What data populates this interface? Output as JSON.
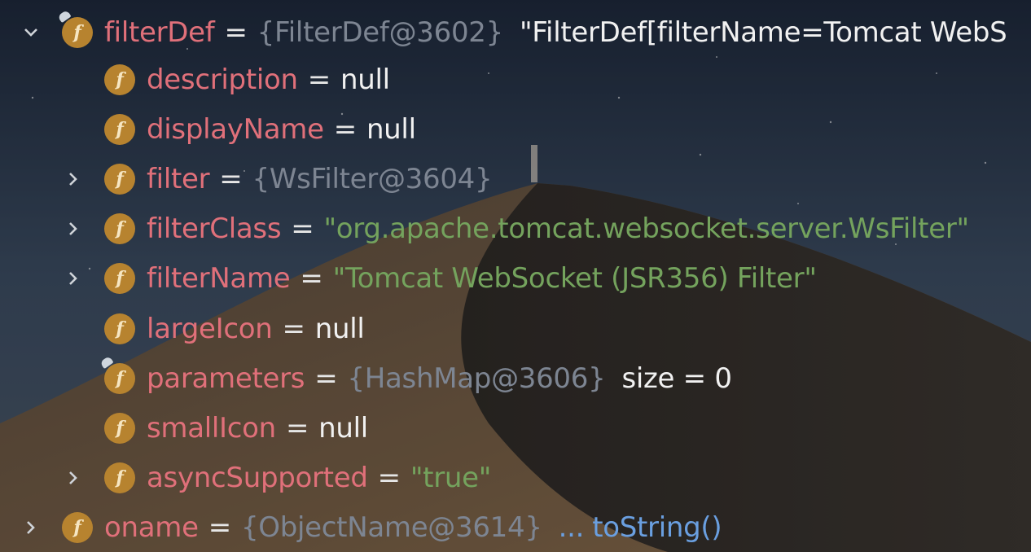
{
  "colors": {
    "field_name": "#e0707a",
    "reference": "#7d8592",
    "string": "#74a35d",
    "value": "#f1f1f1",
    "link": "#6a9fe0",
    "field_icon": "#b7832f"
  },
  "rows": [
    {
      "name": "filterDef",
      "ref": "{FilterDef@3602}",
      "str": "\"FilterDef[filterName=Tomcat WebS",
      "icon": "field-icon",
      "pinned": true
    },
    {
      "name": "description",
      "val": "null",
      "icon": "field-icon"
    },
    {
      "name": "displayName",
      "val": "null",
      "icon": "field-icon"
    },
    {
      "name": "filter",
      "ref": "{WsFilter@3604}",
      "icon": "field-icon"
    },
    {
      "name": "filterClass",
      "str": "\"org.apache.tomcat.websocket.server.WsFilter\"",
      "icon": "field-icon"
    },
    {
      "name": "filterName",
      "str": "\"Tomcat WebSocket (JSR356) Filter\"",
      "icon": "field-icon"
    },
    {
      "name": "largeIcon",
      "val": "null",
      "icon": "field-icon"
    },
    {
      "name": "parameters",
      "ref": "{HashMap@3606}",
      "extra": "size = 0",
      "icon": "field-icon",
      "pinned": true
    },
    {
      "name": "smallIcon",
      "val": "null",
      "icon": "field-icon"
    },
    {
      "name": "asyncSupported",
      "str": "\"true\"",
      "icon": "field-icon"
    },
    {
      "name": "oname",
      "ref": "{ObjectName@3614}",
      "ellipsis": "...",
      "link": "toString()",
      "icon": "field-icon"
    }
  ],
  "field_icon_glyph": "f",
  "equals": "="
}
